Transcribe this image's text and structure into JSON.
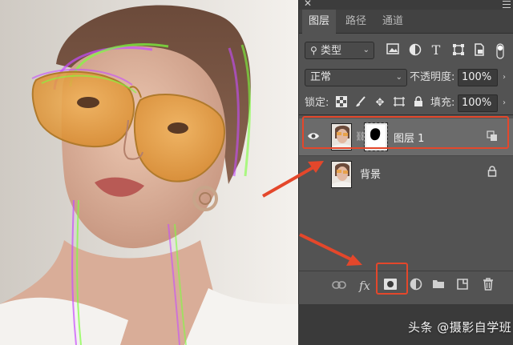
{
  "panel": {
    "tabs": [
      {
        "label": "图层",
        "active": true
      },
      {
        "label": "路径",
        "active": false
      },
      {
        "label": "通道",
        "active": false
      }
    ],
    "filter": {
      "label": "类型",
      "icons": [
        "image-filter-icon",
        "adjustment-filter-icon",
        "type-filter-icon",
        "shape-filter-icon",
        "smart-object-filter-icon",
        "filter-toggle-icon"
      ]
    },
    "blend_mode": "正常",
    "opacity_label": "不透明度:",
    "opacity_value": "100%",
    "lock_label": "锁定:",
    "fill_label": "填充:",
    "fill_value": "100%",
    "layers": [
      {
        "name": "图层 1",
        "selected": true,
        "visible": true,
        "has_mask": true
      },
      {
        "name": "背景",
        "selected": false,
        "visible": false,
        "locked": true
      }
    ],
    "bottom_icons": [
      "link-layers-icon",
      "fx-icon",
      "add-mask-icon",
      "adjustment-layer-icon",
      "group-folder-icon",
      "new-layer-icon",
      "delete-icon"
    ],
    "fx_label": "fx"
  },
  "colors": {
    "highlight": "#e4472b",
    "panel_bg": "#535353",
    "selected_row": "#6b6b6b"
  },
  "watermark": "头条 @摄影自学班"
}
